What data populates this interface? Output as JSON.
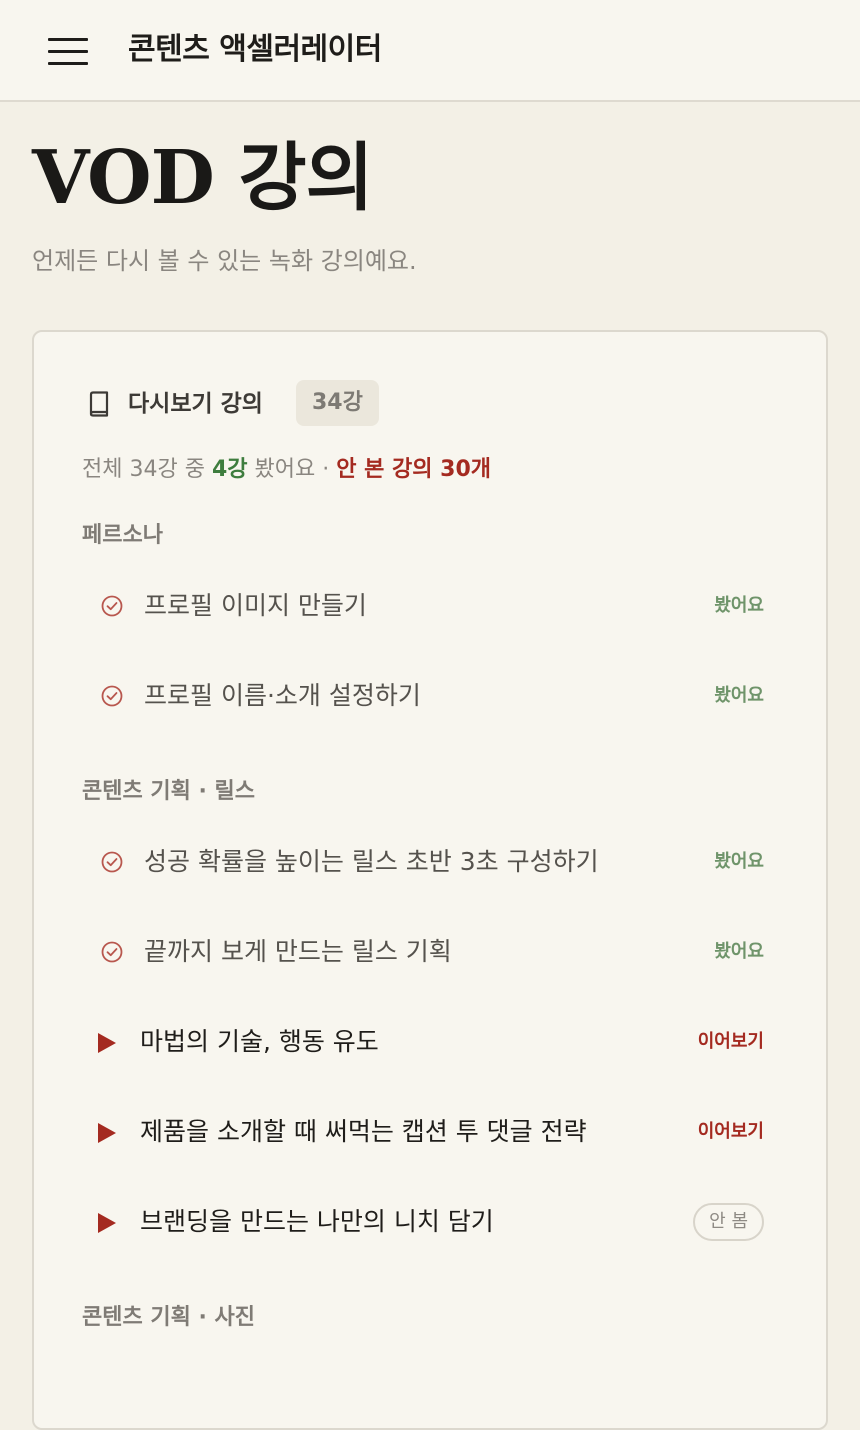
{
  "header": {
    "title": "콘텐츠 액셀러레이터",
    "menu_icon": "hamburger-menu-icon"
  },
  "page": {
    "title": "VOD 강의",
    "subtitle": "언제든 다시 볼 수 있는 녹화 강의예요."
  },
  "library": {
    "title": "다시보기 강의",
    "count_badge": "34강",
    "summary": {
      "prefix": "전체 34강 중 ",
      "watched_count": "4강",
      "middle": " 봤어요 · ",
      "unwatched": "안 본 강의 30개"
    },
    "sections": [
      {
        "heading": "페르소나",
        "lessons": [
          {
            "title": "프로필 이미지 만들기",
            "state": "봤어요",
            "status": "watched"
          },
          {
            "title": "프로필 이름·소개 설정하기",
            "state": "봤어요",
            "status": "watched"
          }
        ]
      },
      {
        "heading": "콘텐츠 기획 · 릴스",
        "lessons": [
          {
            "title": "성공 확률을 높이는 릴스 초반 3초 구성하기",
            "state": "봤어요",
            "status": "watched"
          },
          {
            "title": "끝까지 보게 만드는 릴스 기획",
            "state": "봤어요",
            "status": "watched"
          },
          {
            "title": "마법의 기술, 행동 유도",
            "state": "이어보기",
            "status": "resume"
          },
          {
            "title": "제품을 소개할 때 써먹는 캡션 투 댓글 전략",
            "state": "이어보기",
            "status": "resume"
          },
          {
            "title": "브랜딩을 만드는 나만의 니치 담기",
            "state": "안 봄",
            "status": "not-watched"
          }
        ]
      },
      {
        "heading": "콘텐츠 기획 · 사진",
        "lessons": []
      }
    ]
  },
  "colors": {
    "accent_red": "#a42a20",
    "watched_green": "#6f946a",
    "background": "#f3f0e6"
  }
}
